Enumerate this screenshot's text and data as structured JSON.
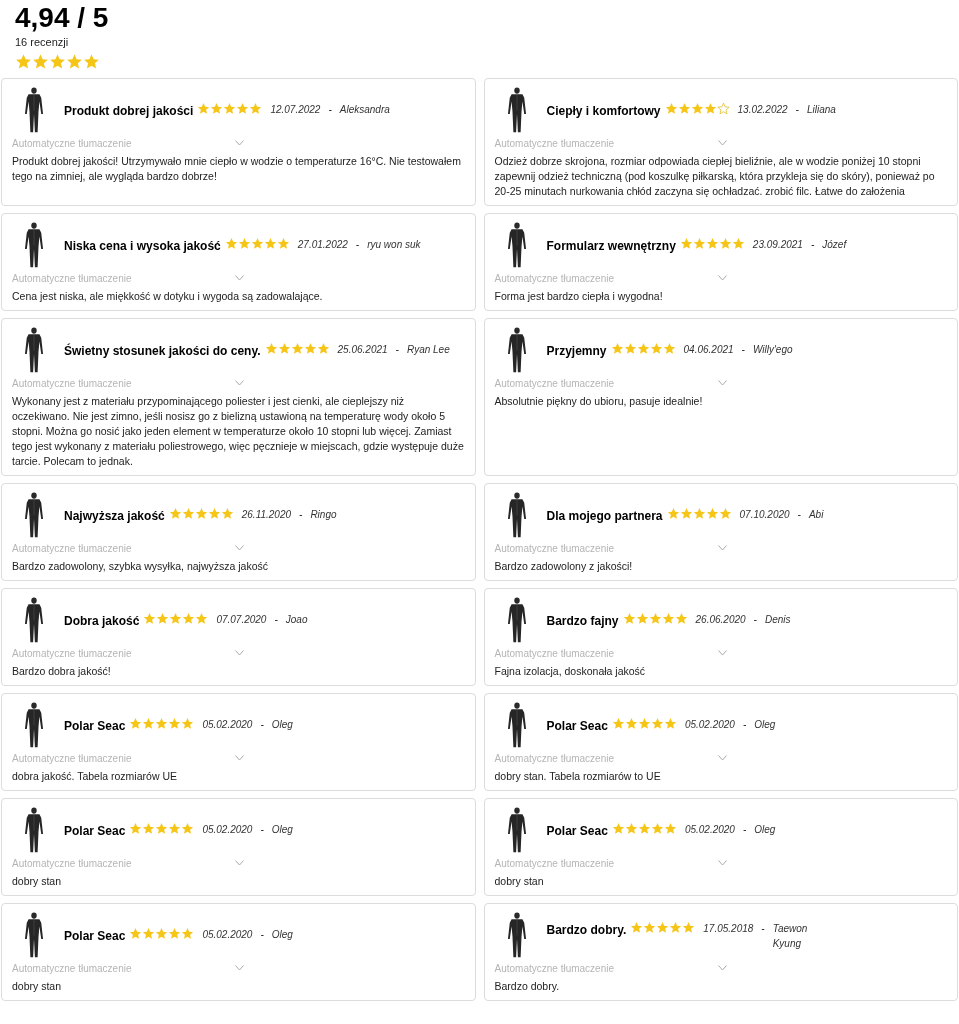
{
  "summary": {
    "score": "4,94 / 5",
    "count": "16 recenzji",
    "stars": 5
  },
  "reviews": [
    {
      "title": "Produkt dobrej jakości",
      "stars": 5,
      "date": "12.07.2022",
      "dash": "-",
      "author": "Aleksandra",
      "translation": "Automatyczne tłumaczenie",
      "text": "Produkt dobrej jakości! Utrzymywało mnie ciepło w wodzie o temperaturze 16°C. Nie testowałem tego na zimniej, ale wygląda bardzo dobrze!"
    },
    {
      "title": "Ciepły i komfortowy",
      "stars": 4,
      "date": "13.02.2022",
      "dash": "-",
      "author": "Liliana",
      "translation": "Automatyczne tłumaczenie",
      "text": "Odzież dobrze skrojona, rozmiar odpowiada ciepłej bieliźnie, ale w wodzie poniżej 10 stopni zapewnij odzież techniczną (pod koszulkę piłkarską, która przykleja się do skóry), ponieważ po 20-25 minutach nurkowania chłód zaczyna się ochładzać. zrobić filc. Łatwe do założenia"
    },
    {
      "title": "Niska cena i wysoka jakość",
      "stars": 5,
      "date": "27.01.2022",
      "dash": "-",
      "author": "ryu won suk",
      "translation": "Automatyczne tłumaczenie",
      "text": "Cena jest niska, ale miękkość w dotyku i wygoda są zadowalające."
    },
    {
      "title": "Formularz wewnętrzny",
      "stars": 5,
      "date": "23.09.2021",
      "dash": "-",
      "author": "Józef",
      "translation": "Automatyczne tłumaczenie",
      "text": "Forma jest bardzo ciepła i wygodna!"
    },
    {
      "title": "Świetny stosunek jakości do ceny.",
      "stars": 5,
      "date": "25.06.2021",
      "dash": "-",
      "author": "Ryan Lee",
      "translation": "Automatyczne tłumaczenie",
      "text": "Wykonany jest z materiału przypominającego poliester i jest cienki, ale cieplejszy niż oczekiwano. Nie jest zimno, jeśli nosisz go z bielizną ustawioną na temperaturę wody około 5 stopni. Można go nosić jako jeden element w temperaturze około 10 stopni lub więcej. Zamiast tego jest wykonany z materiału poliestrowego, więc pęcznieje w miejscach, gdzie występuje duże tarcie. Polecam to jednak."
    },
    {
      "title": "Przyjemny",
      "stars": 5,
      "date": "04.06.2021",
      "dash": "-",
      "author": "Willy'ego",
      "translation": "Automatyczne tłumaczenie",
      "text": "Absolutnie piękny do ubioru, pasuje idealnie!"
    },
    {
      "title": "Najwyższa jakość",
      "stars": 5,
      "date": "26.11.2020",
      "dash": "-",
      "author": "Ringo",
      "translation": "Automatyczne tłumaczenie",
      "text": "Bardzo zadowolony, szybka wysyłka, najwyższa jakość"
    },
    {
      "title": "Dla mojego partnera",
      "stars": 5,
      "date": "07.10.2020",
      "dash": "-",
      "author": "Abi",
      "translation": "Automatyczne tłumaczenie",
      "text": "Bardzo zadowolony z jakości!"
    },
    {
      "title": "Dobra jakość",
      "stars": 5,
      "date": "07.07.2020",
      "dash": "-",
      "author": "Joao",
      "translation": "Automatyczne tłumaczenie",
      "text": "Bardzo dobra jakość!"
    },
    {
      "title": "Bardzo fajny",
      "stars": 5,
      "date": "26.06.2020",
      "dash": "-",
      "author": "Denis",
      "translation": "Automatyczne tłumaczenie",
      "text": "Fajna izolacja, doskonała jakość"
    },
    {
      "title": "Polar Seac",
      "stars": 5,
      "date": "05.02.2020",
      "dash": "-",
      "author": "Oleg",
      "translation": "Automatyczne tłumaczenie",
      "text": "dobra jakość. Tabela rozmiarów UE"
    },
    {
      "title": "Polar Seac",
      "stars": 5,
      "date": "05.02.2020",
      "dash": "-",
      "author": "Oleg",
      "translation": "Automatyczne tłumaczenie",
      "text": "dobry stan. Tabela rozmiarów to UE"
    },
    {
      "title": "Polar Seac",
      "stars": 5,
      "date": "05.02.2020",
      "dash": "-",
      "author": "Oleg",
      "translation": "Automatyczne tłumaczenie",
      "text": "dobry stan"
    },
    {
      "title": "Polar Seac",
      "stars": 5,
      "date": "05.02.2020",
      "dash": "-",
      "author": "Oleg",
      "translation": "Automatyczne tłumaczenie",
      "text": "dobry stan"
    },
    {
      "title": "Polar Seac",
      "stars": 5,
      "date": "05.02.2020",
      "dash": "-",
      "author": "Oleg",
      "translation": "Automatyczne tłumaczenie",
      "text": "dobry stan"
    },
    {
      "title": "Bardzo dobry.",
      "stars": 5,
      "date": "17.05.2018",
      "dash": "-",
      "author": "Taewon Kyung",
      "translation": "Automatyczne tłumaczenie",
      "text": "Bardzo dobry."
    }
  ]
}
